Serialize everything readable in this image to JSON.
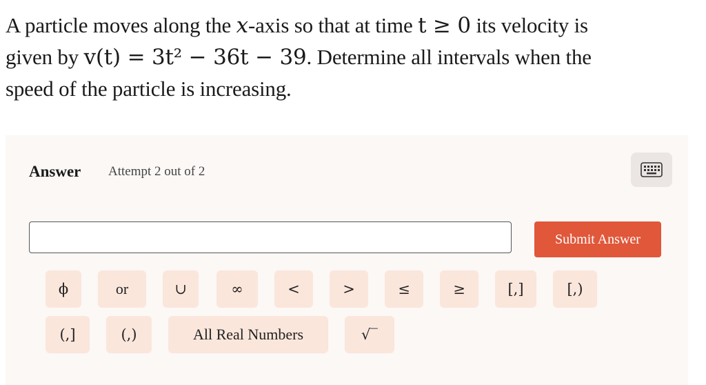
{
  "question": {
    "line1_a": "A particle moves along the ",
    "line1_var_x": "x",
    "line1_b": "-axis so that at time ",
    "line1_math": "t ≥ 0",
    "line1_c": " its velocity is",
    "line2_a": "given by ",
    "line2_math": "v(t) = 3t² − 36t − 39",
    "line2_b": ". Determine all intervals when the",
    "line3": "speed of the particle is increasing."
  },
  "answer": {
    "label": "Answer",
    "attempt": "Attempt 2 out of 2",
    "input_value": "",
    "submit_label": "Submit Answer",
    "keyboard_icon": "keyboard-icon"
  },
  "keypad": {
    "row1": [
      "ϕ",
      "or",
      "∪",
      "∞",
      "<",
      ">",
      "≤",
      "≥",
      "[,]",
      "[,)"
    ],
    "row2": [
      "(,]",
      "(,)",
      "All Real Numbers",
      "√‾"
    ]
  },
  "colors": {
    "accent": "#e0573a",
    "key_bg": "#fbe6dc",
    "panel_bg": "#fbf8f6"
  }
}
